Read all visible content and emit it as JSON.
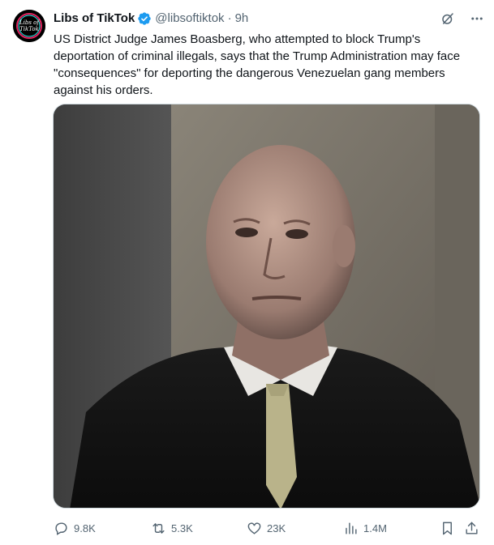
{
  "tweet": {
    "author": {
      "display_name": "Libs of TikTok",
      "handle": "@libsoftiktok",
      "verified": true,
      "avatar_text_line1": "Libs of",
      "avatar_text_line2": "TikTok"
    },
    "separator": "·",
    "time": "9h",
    "text": "US District Judge James Boasberg, who attempted to block Trump's deportation of criminal illegals, says that the Trump Administration may face \"consequences\" for deporting the dangerous Venezuelan gang members against his orders.",
    "media": {
      "kind": "photo",
      "subject": "man in black judicial robe with white shirt and striped tie"
    },
    "metrics": {
      "replies": "9.8K",
      "reposts": "5.3K",
      "likes": "23K",
      "views": "1.4M"
    }
  },
  "colors": {
    "text_primary": "#0f1419",
    "text_secondary": "#536471",
    "verified_blue": "#1d9bf0",
    "border": "#cfd9de"
  },
  "icons": [
    "grok-icon",
    "more-icon",
    "verified-badge-icon",
    "reply-icon",
    "repost-icon",
    "like-icon",
    "views-icon",
    "bookmark-icon",
    "share-icon"
  ]
}
